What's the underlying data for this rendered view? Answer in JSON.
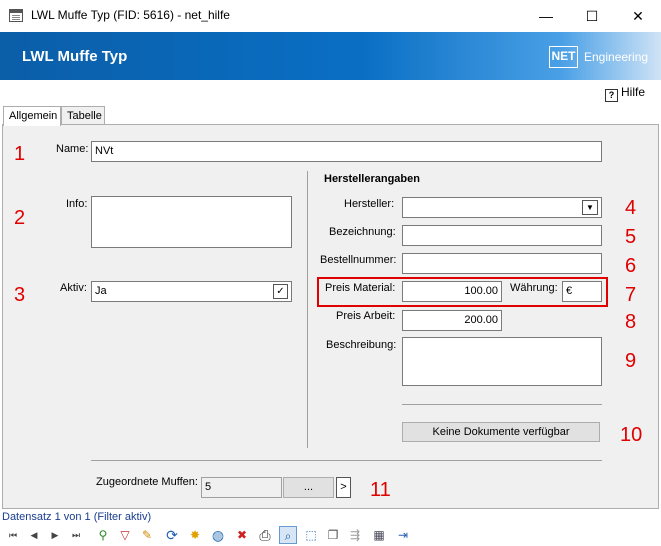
{
  "window": {
    "title": "LWL Muffe Typ (FID: 5616) - net_hilfe",
    "minimize": "—",
    "maximize": "☐",
    "close": "✕"
  },
  "banner": {
    "title": "LWL Muffe Typ",
    "logo": "NET",
    "logo_text": "Engineering"
  },
  "help": {
    "icon": "?",
    "label": "Hilfe"
  },
  "tabs": [
    {
      "label": "Allgemein"
    },
    {
      "label": "Tabelle"
    }
  ],
  "annotations": [
    "1",
    "2",
    "3",
    "4",
    "5",
    "6",
    "7",
    "8",
    "9",
    "10",
    "11"
  ],
  "left": {
    "name_label": "Name:",
    "name_value": "NVt",
    "info_label": "Info:",
    "info_value": "",
    "aktiv_label": "Aktiv:",
    "aktiv_value": "Ja",
    "aktiv_icon": "✓"
  },
  "right": {
    "heading": "Herstellerangaben",
    "hersteller_label": "Hersteller:",
    "hersteller_value": "",
    "dropdown_icon": "▼",
    "bezeichnung_label": "Bezeichnung:",
    "bezeichnung_value": "",
    "bestellnummer_label": "Bestellnummer:",
    "bestellnummer_value": "",
    "preis_material_label": "Preis Material:",
    "preis_material_value": "100.00",
    "waehrung_label": "Währung:",
    "waehrung_value": "€",
    "preis_arbeit_label": "Preis Arbeit:",
    "preis_arbeit_value": "200.00",
    "beschreibung_label": "Beschreibung:",
    "beschreibung_value": "",
    "documents_button": "Keine Dokumente verfügbar"
  },
  "bottom": {
    "zugeordnete_label": "Zugeordnete Muffen:",
    "zugeordnete_value": "5",
    "ellipsis_button": "...",
    "arrow_button": ">"
  },
  "status": "Datensatz 1 von 1 (Filter aktiv)",
  "toolbar": {
    "first": "⏮",
    "prev": "◀",
    "next": "▶",
    "last": "⏭",
    "filter_add": "⚲",
    "filter": "▽",
    "edit": "✎",
    "refresh": "⟳",
    "sun": "✸",
    "globe": "◍",
    "delete": "✖",
    "print": "⎙",
    "zoom": "⌕",
    "select": "⬚",
    "copy": "❐",
    "move": "⇶",
    "table": "▦",
    "exit": "⇥"
  },
  "colors": {
    "accent": "#0b5ea8",
    "annotation": "#e00000",
    "link": "#1a3d8f"
  }
}
